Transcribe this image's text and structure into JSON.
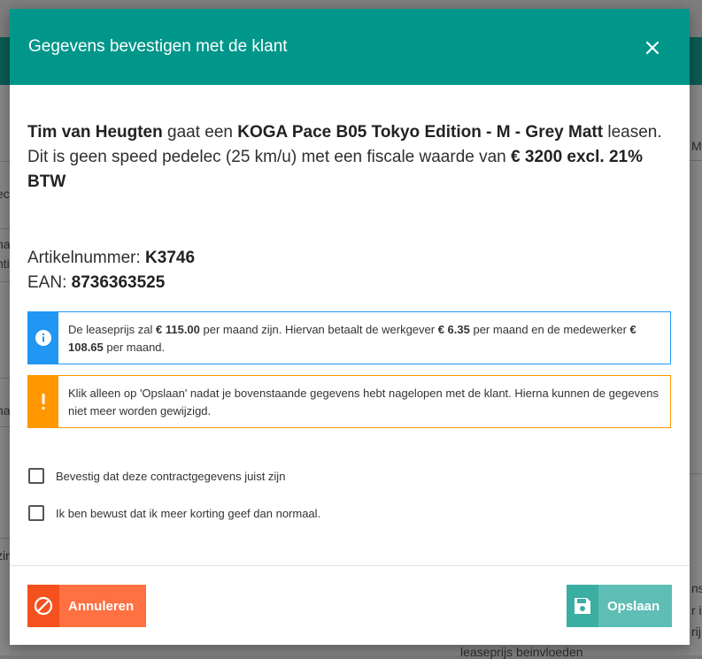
{
  "background": {
    "peek_texts": [
      "M",
      "ec",
      "na",
      "nti",
      "na",
      "zin",
      "ns",
      "r i",
      "rij",
      "leaseprijs beinvloeden"
    ]
  },
  "modal": {
    "title": "Gegevens bevestigen met de klant",
    "intro": {
      "customer_name": "Tim van Heugten",
      "t1": " gaat een ",
      "product": "KOGA Pace B05 Tokyo Edition - M - Grey Matt",
      "t2": " leasen. Dit is geen speed pedelec (25 km/u) met een fiscale waarde van ",
      "value": "€ 3200 excl. 21% BTW"
    },
    "article": {
      "label_article": "Artikelnummer: ",
      "article_number": "K3746",
      "label_ean": "EAN: ",
      "ean": "8736363525"
    },
    "info_alert": {
      "t1": "De leaseprijs zal ",
      "monthly_price": "€ 115.00",
      "t2": " per maand zijn. Hiervan betaalt de werkgever ",
      "employer_amount": "€ 6.35",
      "t3": " per maand en de medewerker ",
      "employee_amount": "€ 108.65",
      "t4": " per maand."
    },
    "warning_alert": {
      "text": "Klik alleen op 'Opslaan' nadat je bovenstaande gegevens hebt nagelopen met de klant. Hierna kunnen de gegevens niet meer worden gewijzigd."
    },
    "checkboxes": [
      {
        "label": "Bevestig dat deze contractgegevens juist zijn",
        "checked": false
      },
      {
        "label": "Ik ben bewust dat ik meer korting geef dan normaal.",
        "checked": false
      }
    ],
    "buttons": {
      "cancel_label": "Annuleren",
      "save_label": "Opslaan"
    }
  },
  "colors": {
    "header": "#00968a",
    "info": "#2196f3",
    "warning": "#ff9800",
    "cancel": "#ff7043",
    "save": "#4db6ac"
  },
  "icons": {
    "close": "close-icon",
    "info": "info-icon",
    "warning": "exclamation-icon",
    "cancel": "ban-icon",
    "save": "floppy-disk-icon"
  }
}
